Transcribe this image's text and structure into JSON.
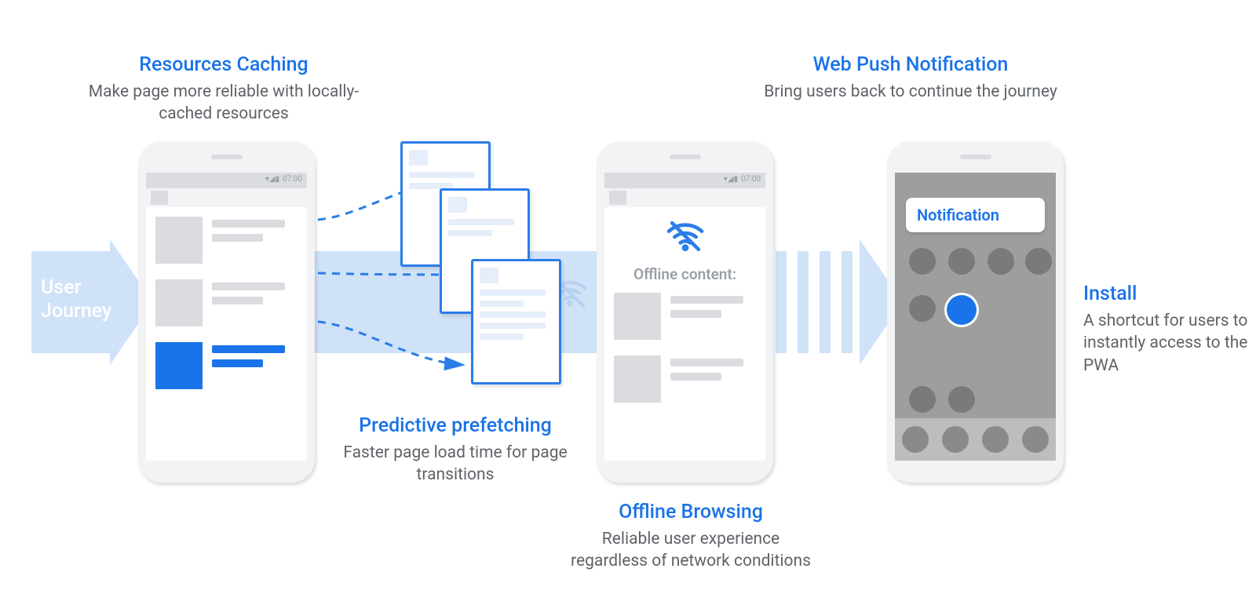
{
  "flow": {
    "label_line1": "User",
    "label_line2": "Journey"
  },
  "caching": {
    "title": "Resources Caching",
    "sub": "Make page more reliable with locally-cached resources"
  },
  "prefetch": {
    "title": "Predictive prefetching",
    "sub": "Faster page load time for page transitions"
  },
  "offline": {
    "title": "Offline Browsing",
    "sub": "Reliable user experience regardless of network conditions",
    "content_heading": "Offline content:"
  },
  "push": {
    "title": "Web Push Notification",
    "sub": "Bring users back to continue the journey",
    "notification_label": "Notification"
  },
  "install": {
    "title": "Install",
    "sub": "A shortcut for users to instantly access to the PWA"
  },
  "status_time": "07:00"
}
